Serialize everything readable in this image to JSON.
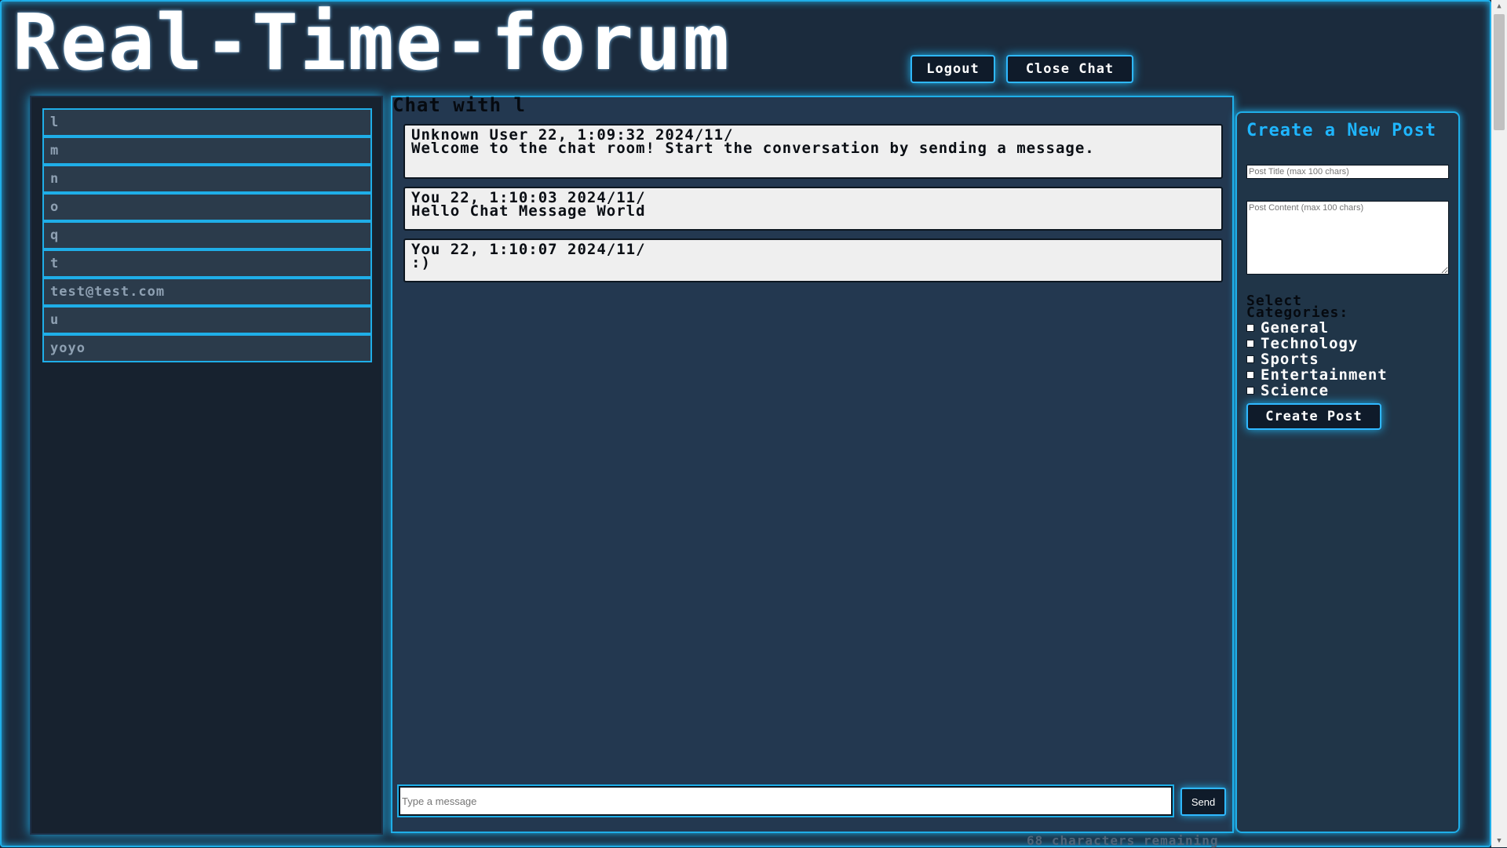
{
  "header": {
    "title": "Real-Time-forum",
    "logout_label": "Logout",
    "close_chat_label": "Close Chat"
  },
  "users": {
    "items": [
      {
        "label": "l"
      },
      {
        "label": "m"
      },
      {
        "label": "n"
      },
      {
        "label": "o"
      },
      {
        "label": "q"
      },
      {
        "label": "t"
      },
      {
        "label": "test@test.com"
      },
      {
        "label": "u"
      },
      {
        "label": "yoyo"
      }
    ]
  },
  "chat": {
    "title": "Chat with l",
    "messages": [
      {
        "meta": "Unknown User 22, 1:09:32 2024/11/",
        "text": "Welcome to the chat room! Start the conversation by sending a message."
      },
      {
        "meta": "You 22, 1:10:03 2024/11/",
        "text": "Hello Chat Message World"
      },
      {
        "meta": "You 22, 1:10:07 2024/11/",
        "text": ":)"
      }
    ],
    "input_placeholder": "Type a message",
    "send_label": "Send",
    "char_remaining": "68 characters remaining"
  },
  "post": {
    "heading": "Create a New Post",
    "title_placeholder": "Post Title (max 100 chars)",
    "content_placeholder": "Post Content (max 100 chars)",
    "categories_label": "Select Categories:",
    "categories": [
      {
        "label": "General"
      },
      {
        "label": "Technology"
      },
      {
        "label": "Sports"
      },
      {
        "label": "Entertainment"
      },
      {
        "label": "Science"
      }
    ],
    "create_label": "Create Post"
  },
  "colors": {
    "accent": "#1faee8",
    "background": "#1b2b3d",
    "heading_accent": "#1fb6ff"
  }
}
